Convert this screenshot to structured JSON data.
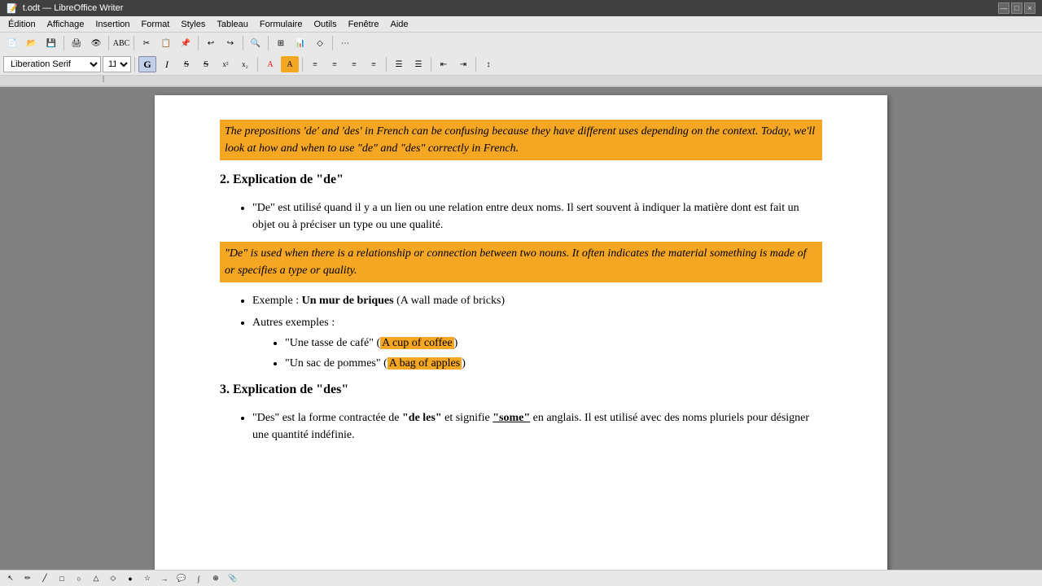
{
  "titleBar": {
    "title": "t.odt — LibreOffice Writer",
    "buttons": [
      "—",
      "□",
      "×"
    ]
  },
  "menuBar": {
    "items": [
      "Édition",
      "Affichage",
      "Insertion",
      "Format",
      "Styles",
      "Tableau",
      "Formulaire",
      "Outils",
      "Fenêtre",
      "Aide"
    ]
  },
  "toolbar": {
    "fontName": "Liberation Serif",
    "fontSize": "11pt",
    "boldLabel": "G",
    "italicLabel": "I",
    "strikeLabel": "S",
    "strikeLabel2": "S",
    "superLabel": "x²",
    "subLabel": "x₂"
  },
  "document": {
    "intro_highlight": "The prepositions 'de' and 'des' in French can be confusing because they have different uses depending on the context. Today, we'll look at how and when to use \"de\" and \"des\" correctly in French.",
    "section2_heading": "2. Explication de \"de\"",
    "bullet1": "\"De\" est utilisé quand il y a un lien ou une relation entre deux noms. Il sert souvent à indiquer la matière dont est fait un objet ou à préciser un type ou une qualité.",
    "de_highlight": "\"De\" is used when there is a relationship or connection between two nouns. It often indicates the material something is made of or specifies a type or quality.",
    "exemple_label": "Exemple :",
    "exemple_bold": "Un mur de briques",
    "exemple_rest": " (A wall made of bricks)",
    "autres_label": "Autres exemples :",
    "ex1_prefix": "\"Une tasse de café\" (",
    "ex1_highlight": "A cup of coffee",
    "ex1_suffix": ")",
    "ex2_prefix": "\"Un sac de pommes\" (",
    "ex2_highlight": "A bag of apples",
    "ex2_suffix": ")",
    "section3_heading": "3. Explication de \"des\"",
    "bullet3": "\"Des\" est la forme contractée de ",
    "bullet3_bold1": "\"de les\"",
    "bullet3_mid": " et signifie ",
    "bullet3_bold2": "\"some\"",
    "bullet3_rest": " en anglais. Il est utilisé avec des noms pluriels pour désigner une quantité indéfinie."
  },
  "statusBar": {
    "icons": [
      "arrow",
      "pencil",
      "line",
      "rect",
      "circle",
      "triangle",
      "diamond",
      "circle2",
      "star",
      "arrow2",
      "callout",
      "equation",
      "insert",
      "clip"
    ]
  }
}
